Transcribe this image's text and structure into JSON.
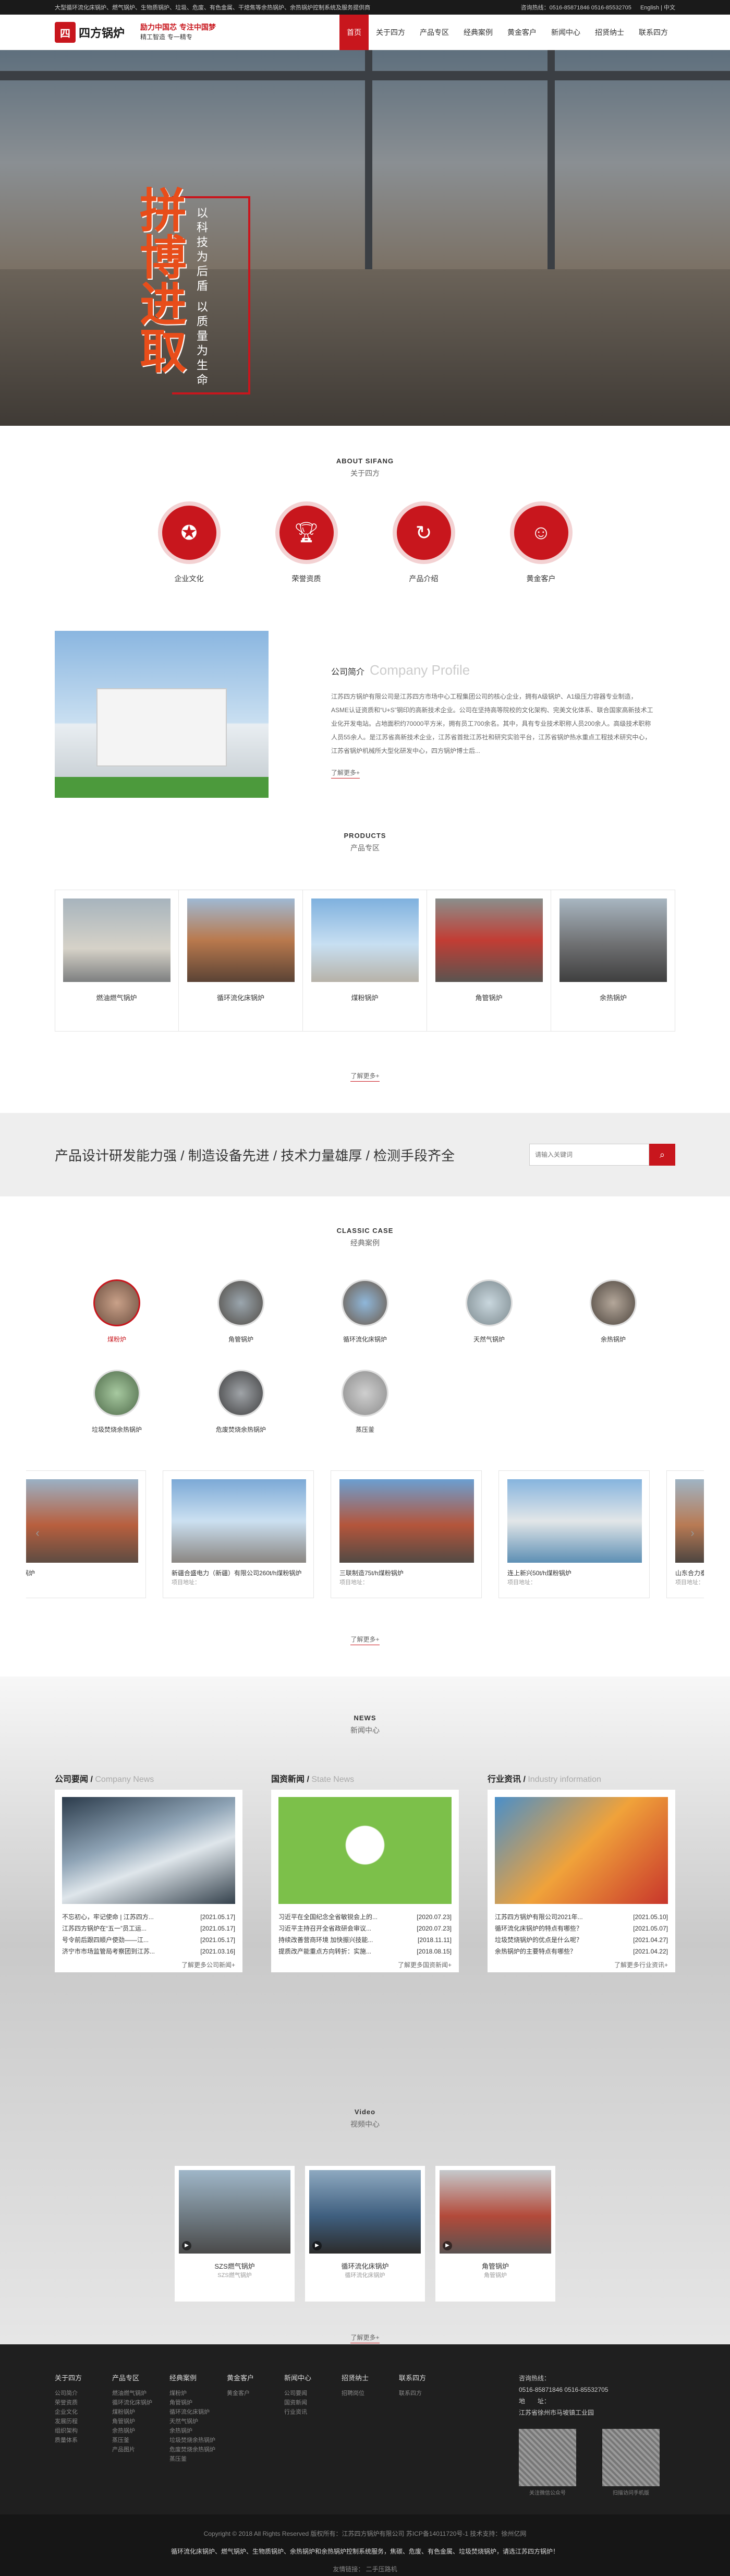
{
  "topbar": {
    "left": "大型循环流化床锅炉、燃气锅炉、生物质锅炉、垃圾、危废、有色金属、干熄焦等余热锅炉、余热锅炉控制系统及服务提供商",
    "hotline_label": "咨询热线：",
    "phones": "0516-85871846  0516-85532705",
    "lang": "English  |  中文"
  },
  "header": {
    "logo_text": "四方锅炉",
    "slogan_line1": "励力中国芯  专注中国梦",
    "slogan_line2": "精工智造   专一精专",
    "nav": [
      "首页",
      "关于四方",
      "产品专区",
      "经典案例",
      "黄金客户",
      "新闻中心",
      "招贤纳士",
      "联系四方"
    ]
  },
  "banner": {
    "title": "拼博进取",
    "sub": "以科技为后盾 以质量为生命"
  },
  "about": {
    "en": "ABOUT SIFANG",
    "cn": "关于四方",
    "icons": [
      {
        "label": "企业文化",
        "icon": "award-icon"
      },
      {
        "label": "荣誉资质",
        "icon": "trophy-icon"
      },
      {
        "label": "产品介绍",
        "icon": "cycle-icon"
      },
      {
        "label": "黄金客户",
        "icon": "user-icon"
      }
    ],
    "profile_head": "公司简介",
    "profile_en": "Company Profile",
    "profile_text": "江苏四方锅炉有限公司是江苏四方市场中心工程集团公司的核心企业，拥有A级锅炉、A1级压力容器专业制造，ASME认证资质和“U+S”钢印的高新技术企业。公司在坚持高等院校的文化架构、完美文化体系、联合国家高新技术工业化开发电站。占地面积约70000平方米，拥有员工700余名。其中，具有专业技术职称人员200余人。高级技术职称人员55余人。是江苏省高新技术企业，江苏省首批江苏社和研究实验平台，江苏省锅炉热水重点工程技术研究中心，江苏省锅炉机械所大型化研发中心，四方锅炉博士后...",
    "more": "了解更多+"
  },
  "products": {
    "en": "PRODUCTS",
    "cn": "产品专区",
    "items": [
      "燃油燃气锅炉",
      "循环流化床锅炉",
      "煤粉锅炉",
      "角管锅炉",
      "余热锅炉"
    ],
    "more": "了解更多+"
  },
  "band": {
    "text": "产品设计研发能力强 / 制造设备先进 / 技术力量雄厚 / 检测手段齐全",
    "search_placeholder": "请输入关键词"
  },
  "cases": {
    "en": "CLASSIC CASE",
    "cn": "经典案例",
    "icons": [
      "煤粉炉",
      "角管锅炉",
      "循环流化床锅炉",
      "天然气锅炉",
      "余热锅炉",
      "垃圾焚烧余热锅炉",
      "危废焚烧余热锅炉",
      "蒸压釜"
    ],
    "slides": [
      {
        "name": "…发电锅炉",
        "sub": ""
      },
      {
        "name": "新疆合盛电力（新疆）有限公司260t/h煤粉锅炉",
        "sub": "项目地址："
      },
      {
        "name": "三联制造75t/h煤粉锅炉",
        "sub": "项目地址："
      },
      {
        "name": "连上新兴50t/h煤粉锅炉",
        "sub": "项目地址："
      },
      {
        "name": "山东合力泰…",
        "sub": "项目地址："
      }
    ],
    "more": "了解更多+"
  },
  "news": {
    "en": "NEWS",
    "cn": "新闻中心",
    "cols": [
      {
        "head": "公司要闻",
        "head_en": "Company News",
        "items": [
          [
            "不忘初心，牢记使命 | 江苏四方...",
            "[2021.05.17]"
          ],
          [
            "江苏四方锅炉在“五一”员工运...",
            "[2021.05.17]"
          ],
          [
            "号令前后跟四顺户使劲——江...",
            "[2021.05.17]"
          ],
          [
            "济宁市市场监管局考察团到江苏...",
            "[2021.03.16]"
          ]
        ],
        "more": "了解更多公司新闻+"
      },
      {
        "head": "国资新闻",
        "head_en": "State News",
        "items": [
          [
            "习近平在全国纪念全省敏锐会上的...",
            "[2020.07.23]"
          ],
          [
            "习近平主持召开全省政研会审议...",
            "[2020.07.23]"
          ],
          [
            "持续改善营商环境 加快振兴技能...",
            "[2018.11.11]"
          ],
          [
            "提质改产能重点方向转折：实施...",
            "[2018.08.15]"
          ]
        ],
        "more": "了解更多国资新闻+"
      },
      {
        "head": "行业资讯",
        "head_en": "Industry information",
        "items": [
          [
            "江苏四方锅炉有限公司2021年...",
            "[2021.05.10]"
          ],
          [
            "循环流化床锅炉的特点有哪些？",
            "[2021.05.07]"
          ],
          [
            "垃圾焚烧锅炉的优点是什么呢？",
            "[2021.04.27]"
          ],
          [
            "余热锅炉的主要特点有哪些？",
            "[2021.04.22]"
          ]
        ],
        "more": "了解更多行业资讯+"
      }
    ]
  },
  "video": {
    "en": "Video",
    "cn": "视频中心",
    "items": [
      {
        "name": "SZS燃气锅炉",
        "sub": "SZS燃气锅炉"
      },
      {
        "name": "循环流化床锅炉",
        "sub": "循环流化床锅炉"
      },
      {
        "name": "角管锅炉",
        "sub": "角管锅炉"
      }
    ],
    "more": "了解更多+"
  },
  "footer": {
    "cols": [
      {
        "head": "关于四方",
        "links": [
          "公司简介",
          "荣誉资质",
          "企业文化",
          "发展历程",
          "组织架构",
          "质量体系"
        ]
      },
      {
        "head": "产品专区",
        "links": [
          "燃油燃气锅炉",
          "循环流化床锅炉",
          "煤粉锅炉",
          "角管锅炉",
          "余热锅炉",
          "蒸压釜",
          "产品图片"
        ]
      },
      {
        "head": "经典案例",
        "links": [
          "煤粉炉",
          "角管锅炉",
          "循环流化床锅炉",
          "天然气锅炉",
          "余热锅炉",
          "垃圾焚烧余热锅炉",
          "危废焚烧余热锅炉",
          "蒸压釜"
        ]
      },
      {
        "head": "黄金客户",
        "links": [
          "黄金客户"
        ]
      },
      {
        "head": "新闻中心",
        "links": [
          "公司要闻",
          "国资新闻",
          "行业资讯"
        ]
      },
      {
        "head": "招贤纳士",
        "links": [
          "招聘岗位"
        ]
      },
      {
        "head": "联系四方",
        "links": [
          "联系四方"
        ]
      }
    ],
    "hotline_label": "咨询热线：",
    "hotline": "0516-85871846  0516-85532705",
    "address_label": "地　　址：",
    "address": "江苏省徐州市马坡镇工业园",
    "qr1": "关注微信公众号",
    "qr2": "扫描访问手机版"
  },
  "copyright": {
    "line1": "Copyright © 2018 All Rights Reserved  版权所有：江苏四方锅炉有限公司  苏ICP备14011720号-1  技术支持：徐州亿网",
    "line2": "循环流化床锅炉、燃气锅炉、生物质锅炉、余热锅炉和余热锅炉控制系统服务，焦碳、危废、有色金属、垃圾焚烧锅炉，请选江苏四方锅炉！",
    "line3": "友情链接： 二手压路机"
  }
}
